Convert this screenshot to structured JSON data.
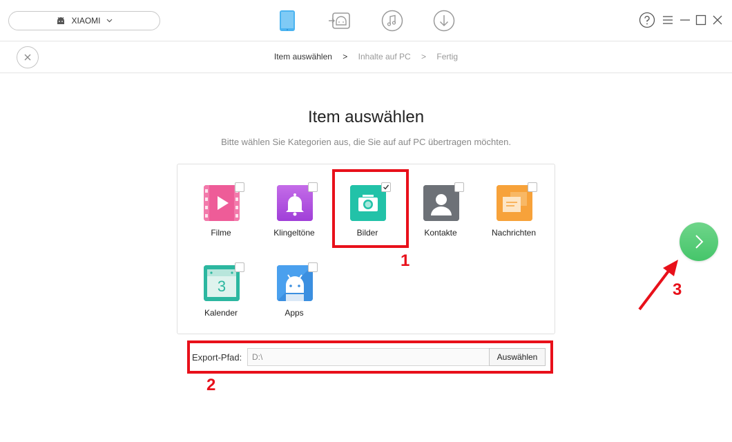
{
  "header": {
    "device_name": "XIAOMI",
    "nav_icons": [
      "phone-icon",
      "android-transfer-icon",
      "music-icon",
      "download-icon"
    ],
    "window_controls": [
      "help-icon",
      "menu-icon",
      "minimize-icon",
      "maximize-icon",
      "close-icon"
    ]
  },
  "breadcrumb": {
    "steps": [
      "Item auswählen",
      "Inhalte auf PC",
      "Fertig"
    ],
    "separator": ">"
  },
  "main": {
    "title": "Item auswählen",
    "subtitle": "Bitte wählen Sie Kategorien aus, die Sie auf auf PC übertragen möchten.",
    "categories": [
      {
        "label": "Filme",
        "icon": "film-icon",
        "color": "#ee5c98",
        "checked": false
      },
      {
        "label": "Klingeltöne",
        "icon": "bell-icon",
        "color": "#b44fe0",
        "checked": false
      },
      {
        "label": "Bilder",
        "icon": "camera-icon",
        "color": "#22c2a8",
        "checked": true
      },
      {
        "label": "Kontakte",
        "icon": "contact-icon",
        "color": "#6d7177",
        "checked": false
      },
      {
        "label": "Nachrichten",
        "icon": "message-icon",
        "color": "#f7a23a",
        "checked": false
      },
      {
        "label": "Kalender",
        "icon": "calendar-icon",
        "color": "#2cb7a0",
        "checked": false,
        "icon_text": "3"
      },
      {
        "label": "Apps",
        "icon": "android-icon",
        "color": "#3b8fe0",
        "checked": false
      }
    ]
  },
  "export": {
    "label": "Export-Pfad:",
    "path": "D:\\",
    "button": "Auswählen"
  },
  "annotations": {
    "n1": "1",
    "n2": "2",
    "n3": "3",
    "color": "#e8101a"
  },
  "accent_next": "#4cc870"
}
